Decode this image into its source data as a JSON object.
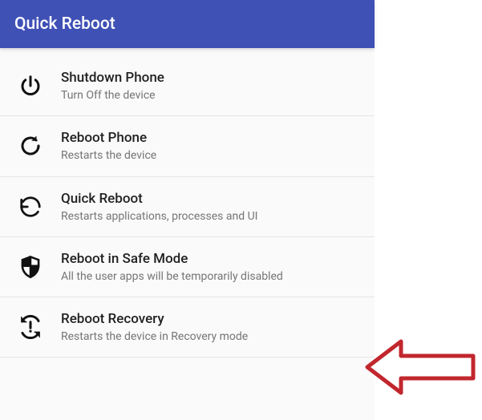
{
  "header": {
    "title": "Quick Reboot"
  },
  "items": [
    {
      "icon": "power-icon",
      "title": "Shutdown Phone",
      "subtitle": "Turn Off the device"
    },
    {
      "icon": "restart-icon",
      "title": "Reboot Phone",
      "subtitle": "Restarts the device"
    },
    {
      "icon": "quick-reboot-icon",
      "title": "Quick Reboot",
      "subtitle": "Restarts applications, processes and UI"
    },
    {
      "icon": "shield-icon",
      "title": "Reboot in Safe Mode",
      "subtitle": "All the user apps will be temporarily disabled"
    },
    {
      "icon": "recovery-icon",
      "title": "Reboot Recovery",
      "subtitle": "Restarts the device in Recovery mode"
    }
  ],
  "annotation": {
    "arrow_color": "#c1272d"
  }
}
